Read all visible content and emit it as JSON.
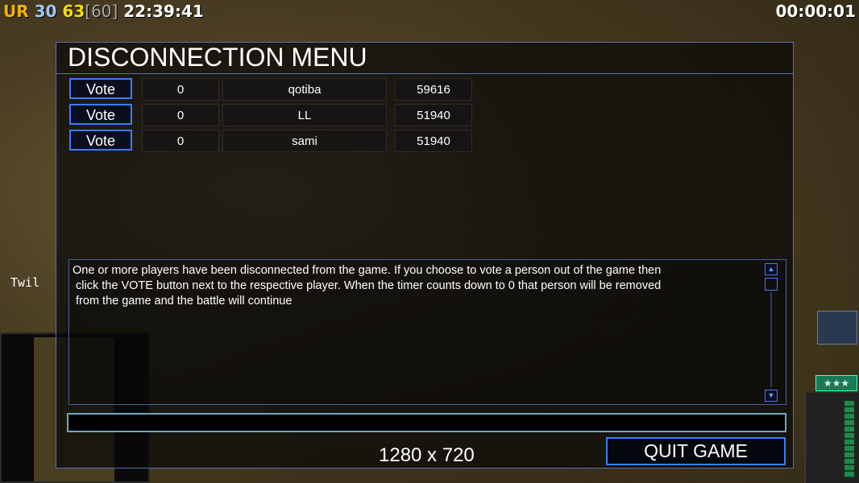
{
  "hud": {
    "ur": "UR",
    "n30": "30",
    "n63": "63",
    "n60": "[60]",
    "clock": "22:39:41",
    "timer": "00:00:01"
  },
  "side_label": "Twil",
  "stars": "★★★",
  "dialog": {
    "title": "DISCONNECTION MENU",
    "vote_label": "Vote",
    "players": [
      {
        "count": "0",
        "name": "qotiba",
        "ping": "59616"
      },
      {
        "count": "0",
        "name": "LL",
        "ping": "51940"
      },
      {
        "count": "0",
        "name": "sami",
        "ping": "51940"
      }
    ],
    "message": "One or more players have been disconnected from the game. If you choose to vote a person out of the game then\n click the VOTE button next to the respective player. When the timer counts down to 0 that person will be removed\n from the game and the battle will continue",
    "chat_value": "",
    "resolution": "1280 x 720",
    "quit_label": "QUIT GAME"
  },
  "icons": {
    "scroll_up": "scroll-up-arrow-icon",
    "scroll_down": "scroll-down-arrow-icon"
  }
}
